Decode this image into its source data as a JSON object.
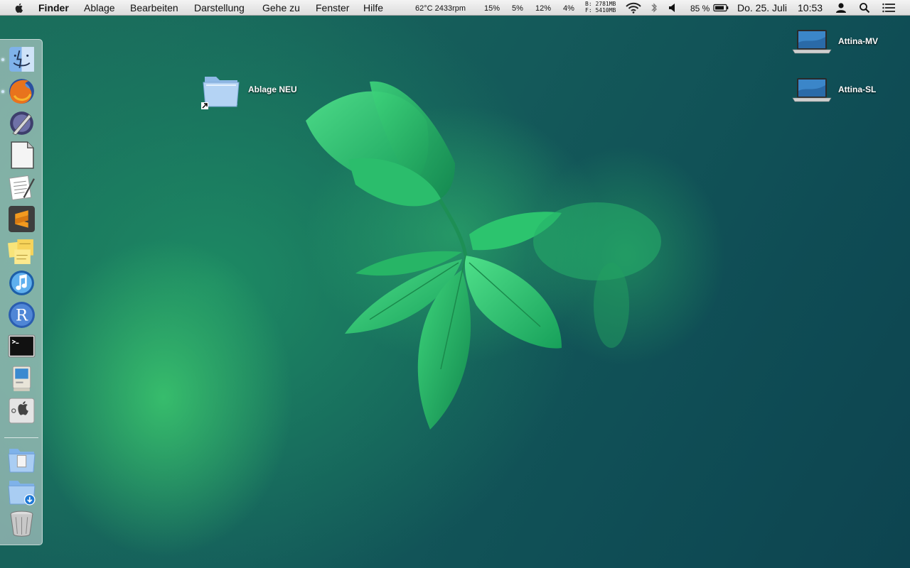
{
  "menubar": {
    "app_name": "Finder",
    "menus": [
      "Ablage",
      "Bearbeiten",
      "Darstellung",
      "Gehe zu",
      "Fenster",
      "Hilfe"
    ],
    "temp_fan": "62°C 2433rpm",
    "cpu_values": [
      "15%",
      "5%",
      "12%",
      "4%"
    ],
    "memory_b": "B: 2781MB",
    "memory_f": "F: 5410MB",
    "battery_percent": "85 %",
    "date": "Do. 25. Juli",
    "time": "10:53"
  },
  "desktop": {
    "folder_label": "Ablage NEU",
    "drives": [
      "Attina-MV",
      "Attina-SL"
    ]
  },
  "dock": {
    "apps": [
      "finder",
      "firefox",
      "preview-pen",
      "document",
      "textedit",
      "sublime-text",
      "stickies",
      "itunes",
      "r",
      "terminal",
      "classic-mac",
      "system-utility"
    ],
    "stack_items": [
      "documents-stack",
      "downloads-stack",
      "trash"
    ]
  },
  "colors": {
    "menubar_bg": "#e8e8e8",
    "desktop_teal": "#145a5a",
    "leaf_green": "#2ec46a"
  }
}
